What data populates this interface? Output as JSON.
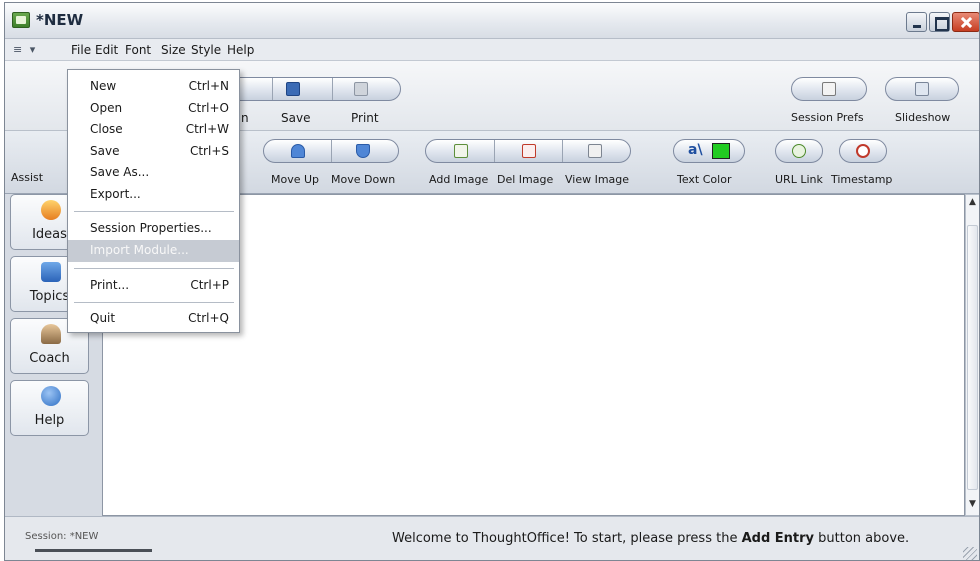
{
  "window": {
    "title": "*NEW"
  },
  "menubar": {
    "system_glyph": "≡ ▾",
    "items": [
      "File",
      "Edit",
      "Font",
      "Size",
      "Style",
      "Help"
    ]
  },
  "toolbar1": {
    "partial_label": "n",
    "save_label": "Save",
    "print_label": "Print",
    "session_prefs_label": "Session Prefs",
    "slideshow_label": "Slideshow"
  },
  "toolbar2": {
    "assist_label": "Assist",
    "move_up_label": "Move Up",
    "move_down_label": "Move Down",
    "add_image_label": "Add Image",
    "del_image_label": "Del Image",
    "view_image_label": "View Image",
    "text_color_label": "Text Color",
    "text_color_glyph": "a\\",
    "text_color_swatch": "#22cc22",
    "url_link_label": "URL Link",
    "timestamp_label": "Timestamp"
  },
  "sidebar": {
    "items": [
      {
        "label": "Ideas",
        "icon": "lightbulb-icon"
      },
      {
        "label": "Topics",
        "icon": "topics-icon"
      },
      {
        "label": "Coach",
        "icon": "coach-icon"
      },
      {
        "label": "Help",
        "icon": "help-icon"
      }
    ]
  },
  "file_menu": {
    "items": [
      {
        "label": "New",
        "shortcut": "Ctrl+N"
      },
      {
        "label": "Open",
        "shortcut": "Ctrl+O"
      },
      {
        "label": "Close",
        "shortcut": "Ctrl+W"
      },
      {
        "label": "Save",
        "shortcut": "Ctrl+S"
      },
      {
        "label": "Save As...",
        "shortcut": ""
      },
      {
        "label": "Export...",
        "shortcut": ""
      },
      {
        "label": "Session Properties...",
        "shortcut": ""
      },
      {
        "label": "Import Module...",
        "shortcut": "",
        "highlighted": true
      },
      {
        "label": "Print...",
        "shortcut": "Ctrl+P"
      },
      {
        "label": "Quit",
        "shortcut": "Ctrl+Q"
      }
    ]
  },
  "statusbar": {
    "session_label": "Session: *NEW",
    "welcome_prefix": "Welcome to ThoughtOffice! To start, please press the ",
    "welcome_bold": "Add Entry",
    "welcome_suffix": " button above."
  },
  "colors": {
    "menu_highlight": "#c6cbd3",
    "close_button": "#c63e22"
  }
}
